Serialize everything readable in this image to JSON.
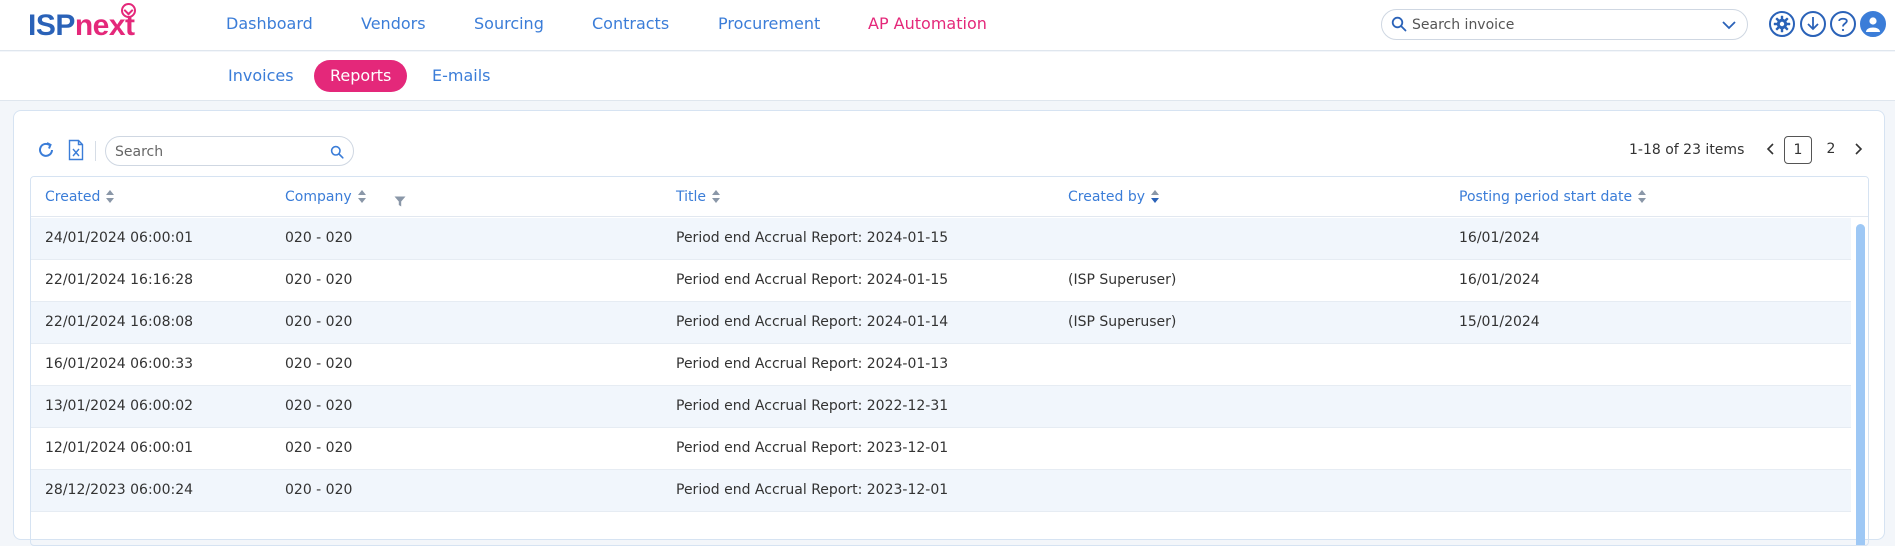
{
  "app": {
    "logo_part1": "ISP",
    "logo_part2": "next",
    "brand_blue": "#2a62b8",
    "brand_pink": "#e4287a"
  },
  "nav": {
    "items": [
      "Dashboard",
      "Vendors",
      "Sourcing",
      "Contracts",
      "Procurement",
      "AP Automation"
    ],
    "active": "AP Automation"
  },
  "search_invoice": {
    "placeholder": "Search invoice",
    "value": ""
  },
  "top_icons": [
    "settings-icon",
    "download-icon",
    "help-icon",
    "user-icon"
  ],
  "subnav": {
    "tabs": [
      "Invoices",
      "Reports",
      "E-mails"
    ],
    "active": "Reports"
  },
  "toolbar": {
    "refresh_icon": "refresh-icon",
    "export_icon": "excel-export-icon",
    "search_placeholder": "Search",
    "search_value": ""
  },
  "pager": {
    "summary": "1-18 of 23 items",
    "pages": [
      "1",
      "2"
    ],
    "current_page": "1"
  },
  "table": {
    "columns": [
      "Created",
      "Company",
      "Title",
      "Created by",
      "Posting period start date"
    ],
    "sorted_column": "Created by",
    "sort_direction": "desc",
    "rows": [
      [
        "24/01/2024 06:00:01",
        "020 - 020",
        "Period end Accrual Report: 2024-01-15",
        "",
        "16/01/2024"
      ],
      [
        "22/01/2024 16:16:28",
        "020 - 020",
        "Period end Accrual Report: 2024-01-15",
        "(ISP Superuser)",
        "16/01/2024"
      ],
      [
        "22/01/2024 16:08:08",
        "020 - 020",
        "Period end Accrual Report: 2024-01-14",
        "(ISP Superuser)",
        "15/01/2024"
      ],
      [
        "16/01/2024 06:00:33",
        "020 - 020",
        "Period end Accrual Report: 2024-01-13",
        "",
        ""
      ],
      [
        "13/01/2024 06:00:02",
        "020 - 020",
        "Period end Accrual Report: 2022-12-31",
        "",
        ""
      ],
      [
        "12/01/2024 06:00:01",
        "020 - 020",
        "Period end Accrual Report: 2023-12-01",
        "",
        ""
      ],
      [
        "28/12/2023 06:00:24",
        "020 - 020",
        "Period end Accrual Report: 2023-12-01",
        "",
        ""
      ]
    ]
  }
}
